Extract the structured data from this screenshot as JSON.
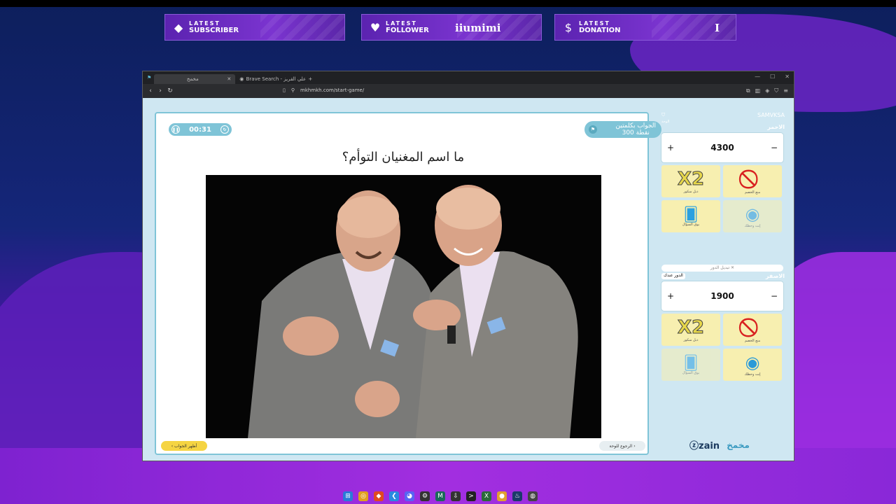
{
  "alerts": [
    {
      "small": "LATEST",
      "big": "SUBSCRIBER",
      "value": "",
      "icon": "diamond-icon",
      "glyph": "◆"
    },
    {
      "small": "LATEST",
      "big": "FOLLOWER",
      "value": "iiumimi",
      "icon": "heart-icon",
      "glyph": "♥"
    },
    {
      "small": "LATEST",
      "big": "DONATION",
      "value": "I",
      "icon": "dollar-icon",
      "glyph": "$"
    }
  ],
  "browser": {
    "tab1": "مخمخ",
    "tab2": "Brave Search - علي القريز",
    "url": "mkhmkh.com/start-game/"
  },
  "game": {
    "timer": "00:31",
    "badge_line1": "الجواب بكلمتين",
    "badge_line2": "300 نقطة",
    "question": "ما اسم المغنيان التوأم؟",
    "reveal_label": "أظهر الجواب",
    "back_label": "الرجوع للوحة"
  },
  "side": {
    "brand": "SAMVKSA",
    "brand_sub": "الوحة",
    "team1": {
      "name": "الاحمر",
      "score": "4300"
    },
    "switch_turn": "تبديل الدور",
    "turn_label": "الدور عندك",
    "team2": {
      "name": "الاصفر",
      "score": "1900"
    },
    "powerups": [
      {
        "glyph": "X2",
        "label": "دبل سكور"
      },
      {
        "glyph": "⃠",
        "label": "منع الخصم"
      },
      {
        "glyph": "🂠",
        "label": "بوق السؤال"
      },
      {
        "glyph": "◉",
        "label": "إنت وحظك"
      }
    ],
    "sponsor": "ⓩzain",
    "logo": "مخمخ"
  },
  "colors": {
    "accent": "#7fc4d7",
    "reveal": "#f5d442",
    "panel": "#cfe7f2"
  }
}
